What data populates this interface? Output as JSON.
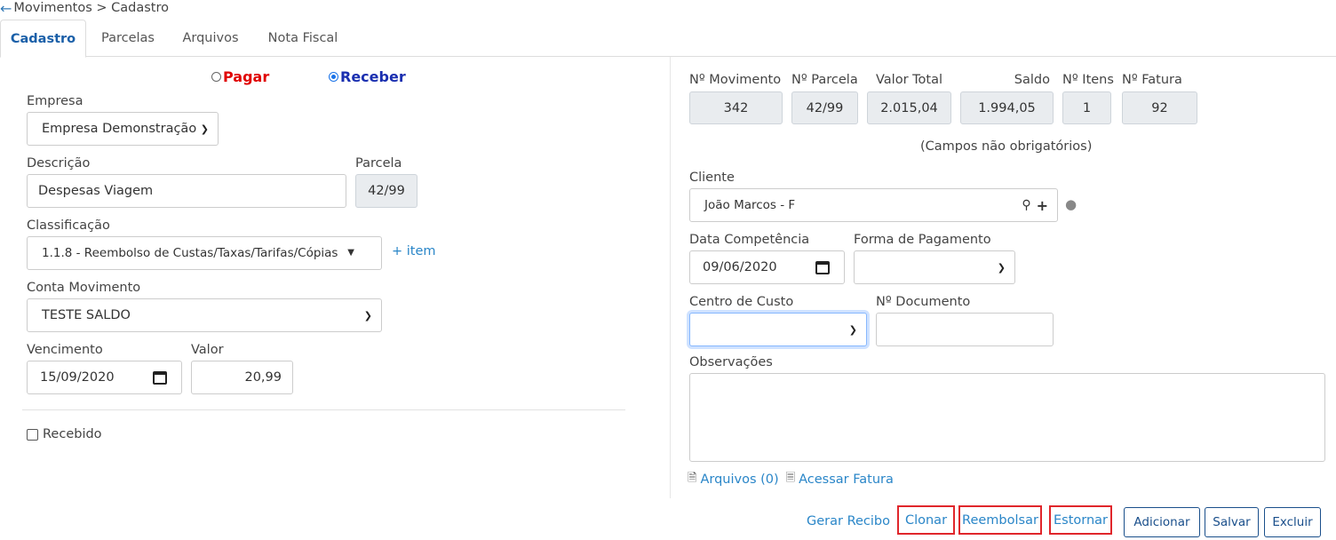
{
  "breadcrumb": {
    "back_icon": "arrow-left-icon",
    "path": "Movimentos > Cadastro"
  },
  "tabs": [
    {
      "label": "Cadastro",
      "active": true
    },
    {
      "label": "Parcelas",
      "active": false
    },
    {
      "label": "Arquivos",
      "active": false
    },
    {
      "label": "Nota Fiscal",
      "active": false
    }
  ],
  "type_radio": {
    "pagar": {
      "label": "Pagar",
      "color": "#e00000",
      "selected": false
    },
    "receber": {
      "label": "Receber",
      "color": "#1a2fb0",
      "selected": true
    }
  },
  "left": {
    "empresa": {
      "label": "Empresa",
      "value": "Empresa Demonstração"
    },
    "descricao": {
      "label": "Descrição",
      "value": "Despesas Viagem"
    },
    "parcela": {
      "label": "Parcela",
      "value": "42/99"
    },
    "classificacao": {
      "label": "Classificação",
      "value": "1.1.8 - Reembolso de Custas/Taxas/Tarifas/Cópias",
      "add_link": "+ item"
    },
    "conta_movimento": {
      "label": "Conta Movimento",
      "value": "TESTE SALDO"
    },
    "vencimento": {
      "label": "Vencimento",
      "value": "15/09/2020"
    },
    "valor": {
      "label": "Valor",
      "value": "20,99"
    },
    "recebido": {
      "label": "Recebido",
      "checked": false
    }
  },
  "summary": {
    "movimento": {
      "label": "Nº Movimento",
      "value": "342"
    },
    "parcela": {
      "label": "Nº Parcela",
      "value": "42/99"
    },
    "valor_total": {
      "label": "Valor Total",
      "value": "2.015,04"
    },
    "saldo": {
      "label": "Saldo",
      "value": "1.994,05"
    },
    "itens": {
      "label": "Nº Itens",
      "value": "1"
    },
    "fatura": {
      "label": "Nº Fatura",
      "value": "92"
    }
  },
  "right": {
    "optional_note": "(Campos não obrigatórios)",
    "cliente": {
      "label": "Cliente",
      "value": "João Marcos - F"
    },
    "data_competencia": {
      "label": "Data Competência",
      "value": "09/06/2020"
    },
    "forma_pagamento": {
      "label": "Forma de Pagamento",
      "value": ""
    },
    "centro_custo": {
      "label": "Centro de Custo",
      "value": ""
    },
    "documento": {
      "label": "Nº Documento",
      "value": ""
    },
    "observacoes": {
      "label": "Observações",
      "value": ""
    },
    "arquivos_link": "Arquivos (0)",
    "fatura_link": "Acessar Fatura"
  },
  "actions": {
    "gerar_recibo": "Gerar Recibo",
    "clonar": "Clonar",
    "reembolsar": "Reembolsar",
    "estornar": "Estornar",
    "adicionar": "Adicionar",
    "salvar": "Salvar",
    "excluir": "Excluir"
  }
}
